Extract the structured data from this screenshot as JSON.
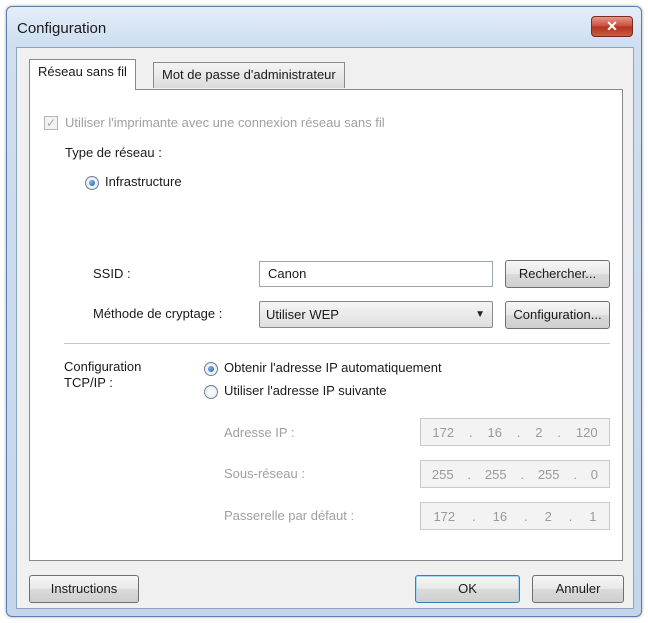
{
  "window": {
    "title": "Configuration",
    "close_glyph": "✕"
  },
  "tabs": [
    {
      "label": "Réseau sans fil",
      "active": true
    },
    {
      "label": "Mot de passe d'administrateur",
      "active": false
    }
  ],
  "wireless": {
    "use_wireless_label": "Utiliser l'imprimante avec une connexion réseau sans fil",
    "use_wireless_checked": true,
    "network_type_label": "Type de réseau :",
    "infrastructure_label": "Infrastructure",
    "ssid_label": "SSID :",
    "ssid_value": "Canon",
    "search_button": "Rechercher...",
    "encryption_label": "Méthode de cryptage :",
    "encryption_value": "Utiliser WEP",
    "encryption_config_button": "Configuration..."
  },
  "tcpip": {
    "label_line1": "Configuration",
    "label_line2": "TCP/IP :",
    "auto_ip_label": "Obtenir l'adresse IP automatiquement",
    "auto_ip_selected": true,
    "manual_ip_label": "Utiliser l'adresse IP suivante",
    "ip_address_label": "Adresse IP :",
    "ip_address": [
      "172",
      "16",
      "2",
      "120"
    ],
    "subnet_label": "Sous-réseau :",
    "subnet": [
      "255",
      "255",
      "255",
      "0"
    ],
    "gateway_label": "Passerelle par défaut :",
    "gateway": [
      "172",
      "16",
      "2",
      "1"
    ]
  },
  "footer": {
    "instructions_button": "Instructions",
    "ok_button": "OK",
    "cancel_button": "Annuler"
  },
  "icons": {
    "checkmark": "✓",
    "dropdown": "▼"
  },
  "colors": {
    "title_gradient_top": "#e4eef9",
    "close_button": "#c8493a",
    "default_button_border": "#3c7fb1",
    "disabled_text": "#a0a0a0"
  }
}
